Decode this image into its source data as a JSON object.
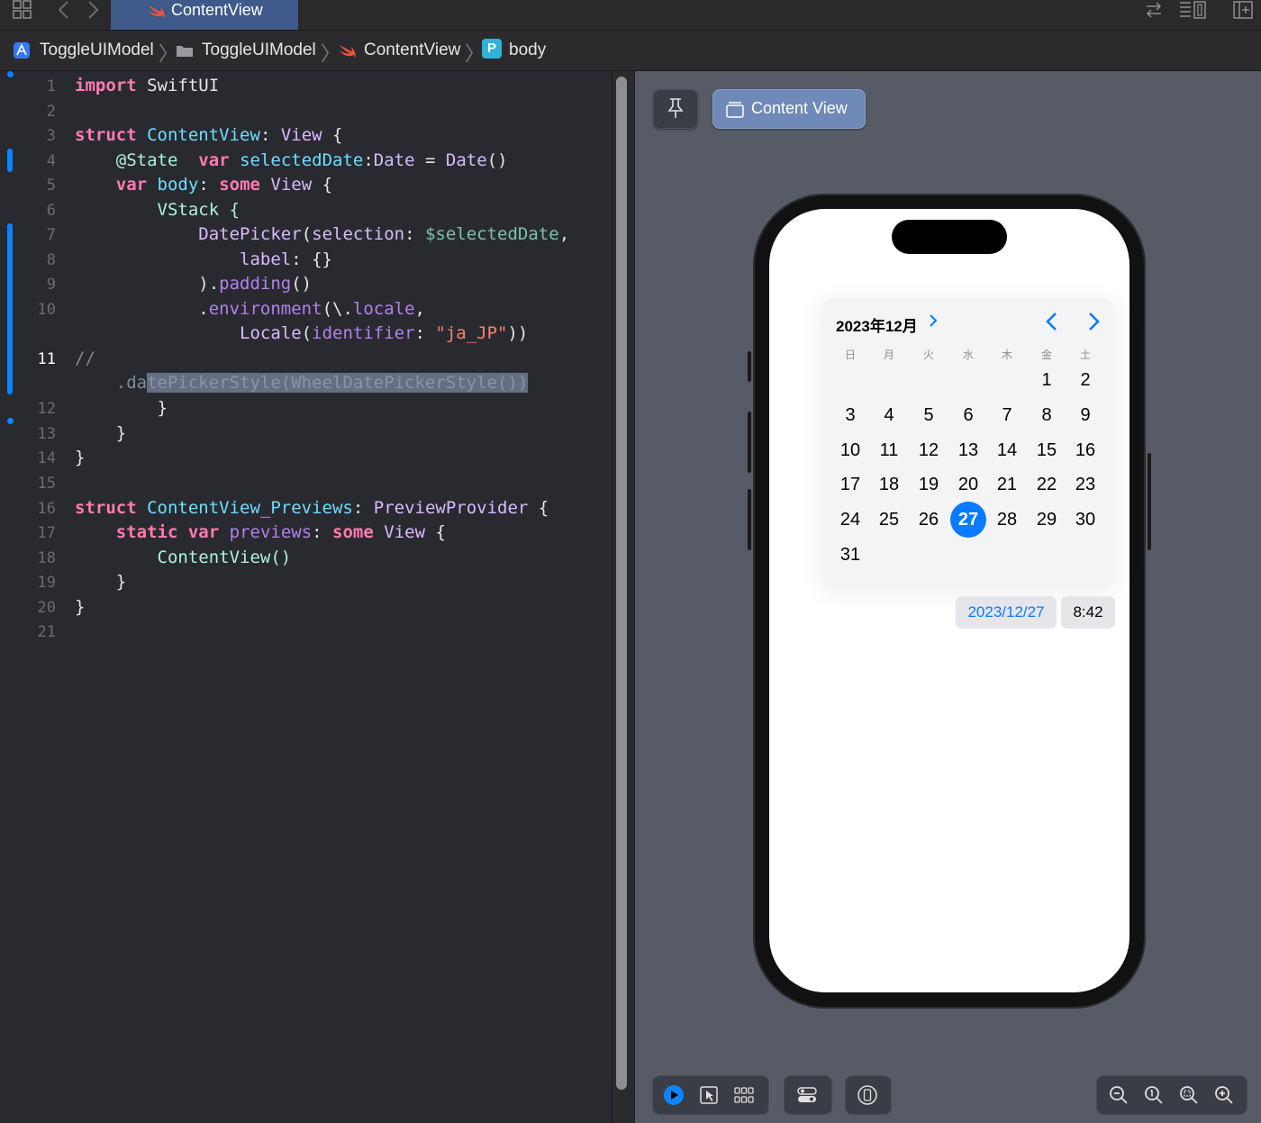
{
  "tabbar": {
    "active_tab": "ContentView"
  },
  "breadcrumb": {
    "project": "ToggleUIModel",
    "folder": "ToggleUIModel",
    "file": "ContentView",
    "symbol_badge": "P",
    "symbol": "body"
  },
  "editor": {
    "line_numbers": [
      "1",
      "2",
      "3",
      "4",
      "5",
      "6",
      "7",
      "8",
      "9",
      "10",
      "11",
      "12",
      "13",
      "14",
      "15",
      "16",
      "17",
      "18",
      "19",
      "20",
      "21"
    ],
    "lines": {
      "l1": [
        "import",
        " SwiftUI"
      ],
      "l3": [
        "struct",
        " ",
        "ContentView",
        ": ",
        "View",
        " {"
      ],
      "l4": [
        "    @State  ",
        "var",
        " ",
        "selectedDate",
        ":",
        "Date",
        " = ",
        "Date",
        "()"
      ],
      "l5": [
        "    ",
        "var",
        " ",
        "body",
        ": ",
        "some",
        " ",
        "View",
        " {"
      ],
      "l6": [
        "        VStack {"
      ],
      "l7": [
        "            ",
        "DatePicker",
        "(",
        "selection",
        ": ",
        "$selectedDate",
        ","
      ],
      "l8": [
        "                ",
        "label",
        ": {}"
      ],
      "l9": [
        "            ).",
        "padding",
        "()"
      ],
      "l10": [
        "            .",
        "environment",
        "(\\.",
        "locale",
        ","
      ],
      "l10b": [
        "                ",
        "Locale",
        "(",
        "identifier",
        ": ",
        "\"ja_JP\"",
        "))"
      ],
      "l11": [
        "//"
      ],
      "l11b": [
        "    .da",
        "tePickerStyle(WheelDatePickerStyle())"
      ],
      "l12": [
        "        }"
      ],
      "l13": [
        "    }"
      ],
      "l14": [
        "}"
      ],
      "l16": [
        "struct",
        " ",
        "ContentView_Previews",
        ": ",
        "PreviewProvider",
        " {"
      ],
      "l17": [
        "    ",
        "static",
        " ",
        "var",
        " ",
        "previews",
        ": ",
        "some",
        " ",
        "View",
        " {"
      ],
      "l18": [
        "        ContentView()"
      ],
      "l19": [
        "    }"
      ],
      "l20": [
        "}"
      ]
    }
  },
  "canvas": {
    "preview_button": "Content View",
    "picker": {
      "month_label": "2023年12月",
      "weekdays": [
        "日",
        "月",
        "火",
        "水",
        "木",
        "金",
        "土"
      ],
      "weeks": [
        [
          "",
          "",
          "",
          "",
          "",
          "1",
          "2"
        ],
        [
          "3",
          "4",
          "5",
          "6",
          "7",
          "8",
          "9"
        ],
        [
          "10",
          "11",
          "12",
          "13",
          "14",
          "15",
          "16"
        ],
        [
          "17",
          "18",
          "19",
          "20",
          "21",
          "22",
          "23"
        ],
        [
          "24",
          "25",
          "26",
          "27",
          "28",
          "29",
          "30"
        ],
        [
          "31",
          "",
          "",
          "",
          "",
          "",
          ""
        ]
      ],
      "selected_day": "27"
    },
    "date_chip": "2023/12/27",
    "time_chip": "8:42"
  }
}
